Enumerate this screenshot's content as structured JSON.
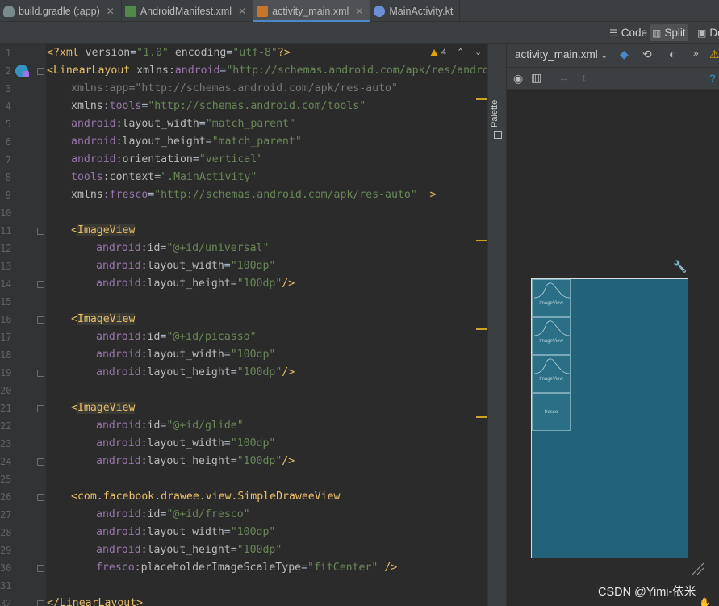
{
  "tabs": [
    {
      "label": "build.gradle (:app)",
      "icon": "gradle-elephant-icon",
      "icon_color": "#7a8b8d",
      "active": false
    },
    {
      "label": "AndroidManifest.xml",
      "icon": "manifest-icon",
      "icon_color": "#4f8a4a",
      "active": false
    },
    {
      "label": "activity_main.xml",
      "icon": "layout-file-icon",
      "icon_color": "#c8742a",
      "active": true
    },
    {
      "label": "MainActivity.kt",
      "icon": "kotlin-icon",
      "icon_color": "#6a8fd8",
      "active": false
    }
  ],
  "view_modes": {
    "code": "Code",
    "split": "Split",
    "design": "De"
  },
  "warnings": {
    "count": "4"
  },
  "code_lines": [
    {
      "n": "1"
    },
    {
      "n": "2"
    },
    {
      "n": "3"
    },
    {
      "n": "4"
    },
    {
      "n": "5"
    },
    {
      "n": "6"
    },
    {
      "n": "7"
    },
    {
      "n": "8"
    },
    {
      "n": "9"
    },
    {
      "n": "10"
    },
    {
      "n": "11"
    },
    {
      "n": "12"
    },
    {
      "n": "13"
    },
    {
      "n": "14"
    },
    {
      "n": "15"
    },
    {
      "n": "16"
    },
    {
      "n": "17"
    },
    {
      "n": "18"
    },
    {
      "n": "19"
    },
    {
      "n": "20"
    },
    {
      "n": "21"
    },
    {
      "n": "22"
    },
    {
      "n": "23"
    },
    {
      "n": "24"
    },
    {
      "n": "25"
    },
    {
      "n": "26"
    },
    {
      "n": "27"
    },
    {
      "n": "28"
    },
    {
      "n": "29"
    },
    {
      "n": "30"
    },
    {
      "n": "31"
    },
    {
      "n": "32"
    }
  ],
  "code": {
    "l1_pi_open": "<?xml ",
    "l1_attr1": "version",
    "l1_eq1": "=",
    "l1_val1": "\"1.0\"",
    "l1_attr2": " encoding",
    "l1_eq2": "=",
    "l1_val2": "\"utf-8\"",
    "l1_pi_close": "?>",
    "l2_tag": "<LinearLayout ",
    "l2_ns": "xmlns",
    "l2_colon": ":",
    "l2_attr": "android",
    "l2_eq": "=",
    "l2_val": "\"http://schemas.android.com/apk/res/androi",
    "l3_text": "xmlns:app=\"http://schemas.android.com/apk/res-auto\"",
    "l4_ns": "xmlns",
    "l4_attr": ":tools",
    "l4_eq": "=",
    "l4_val": "\"http://schemas.android.com/tools\"",
    "l5_ns": "android",
    "l5_attr": ":layout_width",
    "l5_eq": "=",
    "l5_val": "\"match_parent\"",
    "l6_ns": "android",
    "l6_attr": ":layout_height",
    "l6_eq": "=",
    "l6_val": "\"match_parent\"",
    "l7_ns": "android",
    "l7_attr": ":orientation",
    "l7_eq": "=",
    "l7_val": "\"vertical\"",
    "l8_ns": "tools",
    "l8_attr": ":context",
    "l8_eq": "=",
    "l8_val": "\".MainActivity\"",
    "l9_ns": "xmlns",
    "l9_attr": ":fresco",
    "l9_eq": "=",
    "l9_val": "\"http://schemas.android.com/apk/res-auto\"",
    "l9_close": "  >",
    "l11_open": "<",
    "l11_tag": "ImageView",
    "l12_ns": "android",
    "l12_attr": ":id",
    "l12_eq": "=",
    "l12_val": "\"@+id/universal\"",
    "l13_ns": "android",
    "l13_attr": ":layout_width",
    "l13_eq": "=",
    "l13_val": "\"100dp\"",
    "l14_ns": "android",
    "l14_attr": ":layout_height",
    "l14_eq": "=",
    "l14_val": "\"100dp\"",
    "l14_close": "/>",
    "l16_open": "<",
    "l16_tag": "ImageView",
    "l17_ns": "android",
    "l17_attr": ":id",
    "l17_eq": "=",
    "l17_val": "\"@+id/picasso\"",
    "l18_ns": "android",
    "l18_attr": ":layout_width",
    "l18_eq": "=",
    "l18_val": "\"100dp\"",
    "l19_ns": "android",
    "l19_attr": ":layout_height",
    "l19_eq": "=",
    "l19_val": "\"100dp\"",
    "l19_close": "/>",
    "l21_open": "<",
    "l21_tag": "ImageView",
    "l22_ns": "android",
    "l22_attr": ":id",
    "l22_eq": "=",
    "l22_val": "\"@+id/glide\"",
    "l23_ns": "android",
    "l23_attr": ":layout_width",
    "l23_eq": "=",
    "l23_val": "\"100dp\"",
    "l24_ns": "android",
    "l24_attr": ":layout_height",
    "l24_eq": "=",
    "l24_val": "\"100dp\"",
    "l24_close": "/>",
    "l26_tag": "<com.facebook.drawee.view.SimpleDraweeView",
    "l27_ns": "android",
    "l27_attr": ":id",
    "l27_eq": "=",
    "l27_val": "\"@+id/fresco\"",
    "l28_ns": "android",
    "l28_attr": ":layout_width",
    "l28_eq": "=",
    "l28_val": "\"100dp\"",
    "l29_ns": "android",
    "l29_attr": ":layout_height",
    "l29_eq": "=",
    "l29_val": "\"100dp\"",
    "l30_ns": "fresco",
    "l30_attr": ":placeholderImageScaleType",
    "l30_eq": "=",
    "l30_val": "\"fitCenter\"",
    "l30_close": " />",
    "l32_tag": "</LinearLayout>"
  },
  "palette": {
    "label": "Palette"
  },
  "design": {
    "file_selector": "activity_main.xml",
    "more": "»",
    "preview_views": [
      {
        "label": "ImageView"
      },
      {
        "label": "ImageView"
      },
      {
        "label": "ImageView"
      },
      {
        "label": "fresco"
      }
    ]
  },
  "watermark": "CSDN @Yimi-依米"
}
